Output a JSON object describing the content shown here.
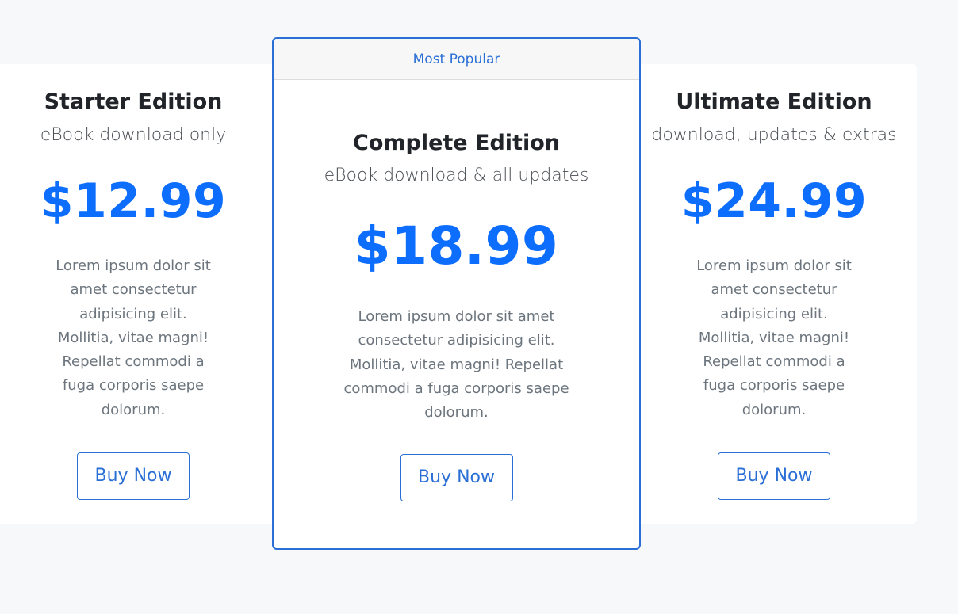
{
  "plans": {
    "starter": {
      "title": "Starter Edition",
      "subtitle": "eBook download only",
      "price": "$12.99",
      "description": "Lorem ipsum dolor sit amet consectetur adipisicing elit. Mollitia, vitae magni! Repellat commodi a fuga corporis saepe dolorum.",
      "button_label": "Buy Now"
    },
    "complete": {
      "badge": "Most Popular",
      "title": "Complete Edition",
      "subtitle": "eBook download & all updates",
      "price": "$18.99",
      "description": "Lorem ipsum dolor sit amet consectetur adipisicing elit. Mollitia, vitae magni! Repellat commodi a fuga corporis saepe dolorum.",
      "button_label": "Buy Now"
    },
    "ultimate": {
      "title": "Ultimate Edition",
      "subtitle": "download, updates & extras",
      "price": "$24.99",
      "description": "Lorem ipsum dolor sit amet consectetur adipisicing elit. Mollitia, vitae magni! Repellat commodi a fuga corporis saepe dolorum.",
      "button_label": "Buy Now"
    }
  },
  "colors": {
    "accent": "#0d6efd",
    "border_accent": "#2a6fd6",
    "text_muted": "#6c757d",
    "background": "#f7f8fa"
  }
}
